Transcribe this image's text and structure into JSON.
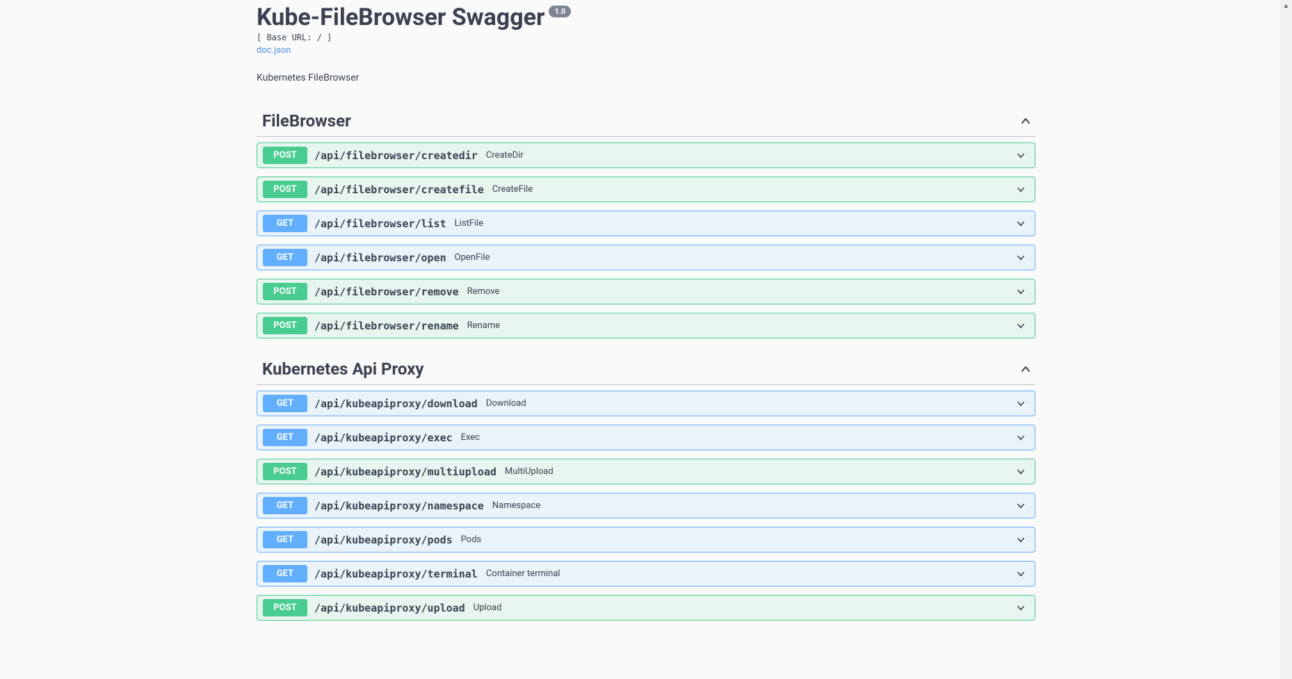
{
  "header": {
    "title": "Kube-FileBrowser Swagger",
    "version": "1.0",
    "base_url": "[ Base URL: / ]",
    "doc_link": "doc.json",
    "description": "Kubernetes FileBrowser"
  },
  "tags": [
    {
      "name": "FileBrowser",
      "operations": [
        {
          "method": "POST",
          "path": "/api/filebrowser/createdir",
          "summary": "CreateDir"
        },
        {
          "method": "POST",
          "path": "/api/filebrowser/createfile",
          "summary": "CreateFile"
        },
        {
          "method": "GET",
          "path": "/api/filebrowser/list",
          "summary": "ListFile"
        },
        {
          "method": "GET",
          "path": "/api/filebrowser/open",
          "summary": "OpenFile"
        },
        {
          "method": "POST",
          "path": "/api/filebrowser/remove",
          "summary": "Remove"
        },
        {
          "method": "POST",
          "path": "/api/filebrowser/rename",
          "summary": "Rename"
        }
      ]
    },
    {
      "name": "Kubernetes Api Proxy",
      "operations": [
        {
          "method": "GET",
          "path": "/api/kubeapiproxy/download",
          "summary": "Download"
        },
        {
          "method": "GET",
          "path": "/api/kubeapiproxy/exec",
          "summary": "Exec"
        },
        {
          "method": "POST",
          "path": "/api/kubeapiproxy/multiupload",
          "summary": "MultiUpload"
        },
        {
          "method": "GET",
          "path": "/api/kubeapiproxy/namespace",
          "summary": "Namespace"
        },
        {
          "method": "GET",
          "path": "/api/kubeapiproxy/pods",
          "summary": "Pods"
        },
        {
          "method": "GET",
          "path": "/api/kubeapiproxy/terminal",
          "summary": "Container terminal"
        },
        {
          "method": "POST",
          "path": "/api/kubeapiproxy/upload",
          "summary": "Upload"
        }
      ]
    }
  ]
}
